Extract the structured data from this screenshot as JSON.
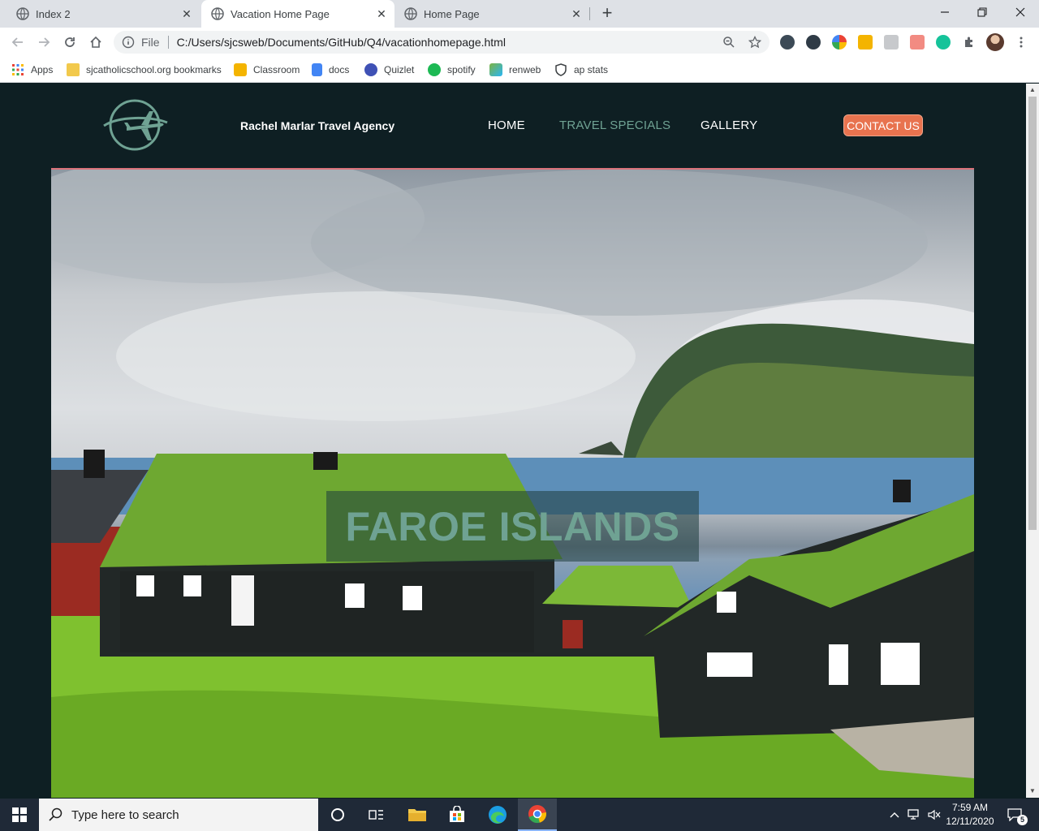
{
  "browser": {
    "tabs": [
      {
        "title": "Index 2",
        "active": false
      },
      {
        "title": "Vacation Home Page",
        "active": true
      },
      {
        "title": "Home Page",
        "active": false
      }
    ],
    "address": {
      "scheme_label": "File",
      "url": "C:/Users/sjcsweb/Documents/GitHub/Q4/vacationhomepage.html"
    },
    "bookmarks": [
      {
        "label": "Apps",
        "icon": "apps-grid-icon"
      },
      {
        "label": "sjcatholicschool.org bookmarks",
        "icon": "folder-icon"
      },
      {
        "label": "Classroom",
        "icon": "classroom-icon"
      },
      {
        "label": "docs",
        "icon": "docs-icon"
      },
      {
        "label": "Quizlet",
        "icon": "quizlet-icon"
      },
      {
        "label": "spotify",
        "icon": "spotify-icon"
      },
      {
        "label": "renweb",
        "icon": "renweb-icon"
      },
      {
        "label": "ap stats",
        "icon": "shield-icon"
      }
    ]
  },
  "site": {
    "agency_name": "Rachel Marlar Travel Agency",
    "nav": {
      "home": "HOME",
      "specials": "TRAVEL SPECIALS",
      "gallery": "GALLERY",
      "contact": "CONTACT US"
    },
    "hero_title": "FAROE ISLANDS",
    "colors": {
      "background": "#0e1f23",
      "accent": "#6fa293",
      "contact_button": "#e8734f",
      "nav_text": "#ffffff"
    }
  },
  "taskbar": {
    "search_placeholder": "Type here to search",
    "time": "7:59 AM",
    "date": "12/11/2020",
    "notifications": "5"
  }
}
